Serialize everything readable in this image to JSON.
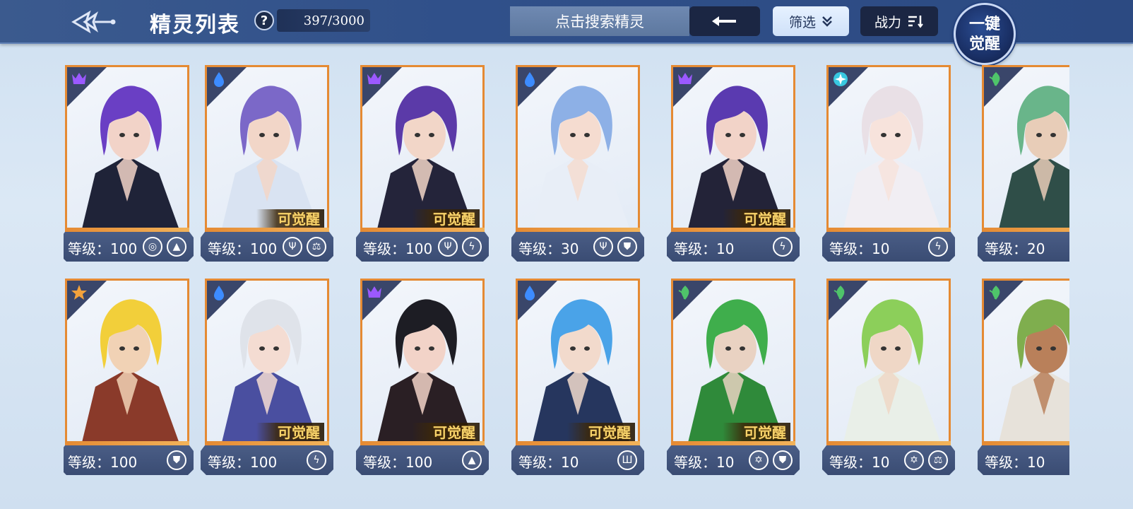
{
  "header": {
    "title": "精灵列表",
    "help_label": "?",
    "count": "397/3000",
    "search_placeholder": "点击搜索精灵",
    "back_label": "←",
    "filter_label": "筛选",
    "filter_icon": "chevron-double-down-icon",
    "power_label": "战力",
    "sort_icon": "sort-icon",
    "awaken_label": "一键觉醒"
  },
  "colors": {
    "topbar": "#30508a",
    "card_border": "#e58a33",
    "plate": "#3a4c73",
    "awaken_text": "#f7d36b"
  },
  "cards": [
    {
      "level": "等级：100",
      "element": "dark-demon-icon",
      "element_color": "#9b59ff",
      "hair": "#6a3fc4",
      "skin": "#f2d3c8",
      "outfit": "#1f2338",
      "awakenable": "",
      "icons": [
        "whirl-icon",
        "book-icon"
      ]
    },
    {
      "level": "等级：100",
      "element": "water-drop-icon",
      "element_color": "#3d8cff",
      "hair": "#7b68c8",
      "skin": "#f2d6c8",
      "outfit": "#d9e3f2",
      "awakenable": "可觉醒",
      "icons": [
        "trident-icon",
        "balance-icon"
      ]
    },
    {
      "level": "等级：100",
      "element": "dark-demon-icon",
      "element_color": "#9b59ff",
      "hair": "#5b3aa8",
      "skin": "#f2d6c8",
      "outfit": "#24243a",
      "awakenable": "可觉醒",
      "icons": [
        "trident-icon",
        "lightning-icon"
      ]
    },
    {
      "level": "等级：30",
      "element": "water-drop-icon",
      "element_color": "#3d8cff",
      "hair": "#8db0e6",
      "skin": "#f5dcd0",
      "outfit": "#e8eef7",
      "awakenable": "",
      "icons": [
        "trident-icon",
        "shield-icon"
      ]
    },
    {
      "level": "等级：10",
      "element": "dark-demon-icon",
      "element_color": "#9b59ff",
      "hair": "#5a3ab0",
      "skin": "#f2d3c8",
      "outfit": "#232338",
      "awakenable": "可觉醒",
      "icons": [
        "lightning-icon"
      ]
    },
    {
      "level": "等级：10",
      "element": "light-star-icon",
      "element_color": "#38c8e0",
      "hair": "#e9e0e6",
      "skin": "#f7e3dc",
      "outfit": "#f1eef3",
      "awakenable": "",
      "icons": [
        "lightning-icon"
      ]
    },
    {
      "level": "等级：20",
      "element": "wind-leaf-icon",
      "element_color": "#4fc46a",
      "hair": "#69b58a",
      "skin": "#e8cdb8",
      "outfit": "#2f4e48",
      "awakenable": "",
      "icons": []
    },
    {
      "level": "等级：100",
      "element": "fire-star-icon",
      "element_color": "#f2a23c",
      "hair": "#f2cf3a",
      "skin": "#f1d2b5",
      "outfit": "#8a3a2a",
      "awakenable": "",
      "icons": [
        "shield-icon"
      ]
    },
    {
      "level": "等级：100",
      "element": "water-drop-icon",
      "element_color": "#3d8cff",
      "hair": "#dfe3ea",
      "skin": "#f4dcd2",
      "outfit": "#4a4fa0",
      "awakenable": "可觉醒",
      "icons": [
        "lightning-icon"
      ]
    },
    {
      "level": "等级：100",
      "element": "dark-demon-icon",
      "element_color": "#9b59ff",
      "hair": "#1d1d24",
      "skin": "#f2d3c8",
      "outfit": "#2a1f24",
      "awakenable": "可觉醒",
      "icons": [
        "book-icon"
      ]
    },
    {
      "level": "等级：10",
      "element": "water-drop-icon",
      "element_color": "#3d8cff",
      "hair": "#4aa3e8",
      "skin": "#f2dacc",
      "outfit": "#26365e",
      "awakenable": "可觉醒",
      "icons": [
        "claw-icon"
      ]
    },
    {
      "level": "等级：10",
      "element": "wind-leaf-icon",
      "element_color": "#4fc46a",
      "hair": "#3fae4c",
      "skin": "#e9d2c2",
      "outfit": "#2f8a3a",
      "awakenable": "可觉醒",
      "icons": [
        "hexagram-icon",
        "shield-icon"
      ]
    },
    {
      "level": "等级：10",
      "element": "wind-leaf-icon",
      "element_color": "#4fc46a",
      "hair": "#8ccf5a",
      "skin": "#efd7c6",
      "outfit": "#e9efe8",
      "awakenable": "",
      "icons": [
        "hexagram-icon",
        "balance-icon"
      ]
    },
    {
      "level": "等级：10",
      "element": "wind-leaf-icon",
      "element_color": "#4fc46a",
      "hair": "#7fae4e",
      "skin": "#b9805a",
      "outfit": "#e7e2da",
      "awakenable": "",
      "icons": []
    }
  ]
}
